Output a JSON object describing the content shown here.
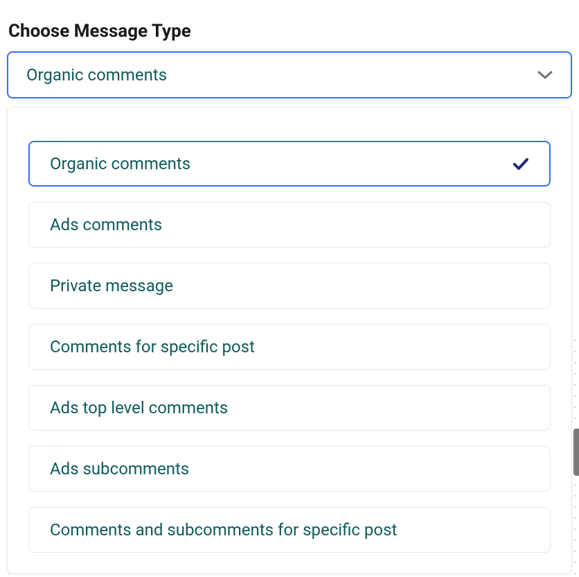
{
  "field": {
    "label": "Choose Message Type",
    "selected_value": "Organic comments"
  },
  "options": [
    {
      "label": "Organic comments",
      "selected": true
    },
    {
      "label": "Ads comments",
      "selected": false
    },
    {
      "label": "Private message",
      "selected": false
    },
    {
      "label": "Comments for specific post",
      "selected": false
    },
    {
      "label": "Ads top level comments",
      "selected": false
    },
    {
      "label": "Ads subcomments",
      "selected": false
    },
    {
      "label": "Comments and subcomments for specific post",
      "selected": false
    }
  ],
  "colors": {
    "focus_border": "#3b6cf5",
    "option_text": "#0f5a5a",
    "check_color": "#1e2a78"
  }
}
